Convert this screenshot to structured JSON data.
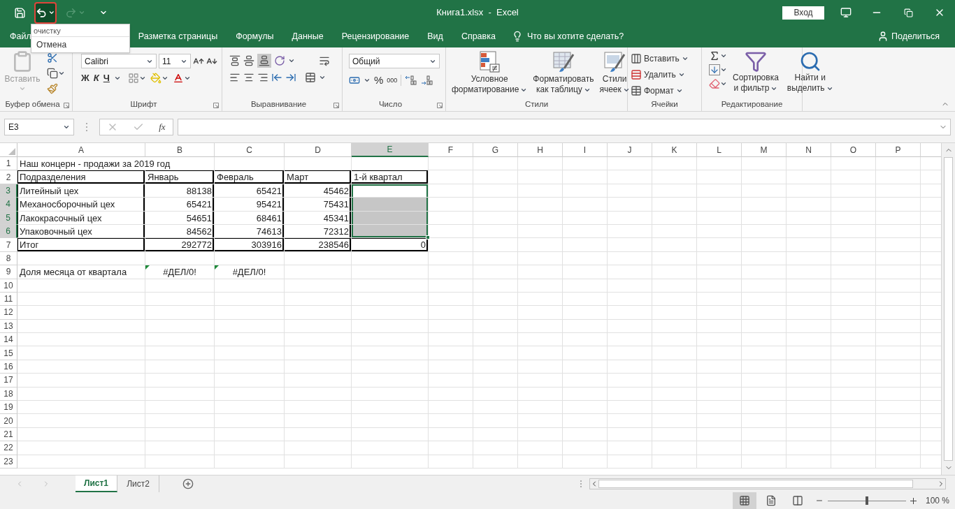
{
  "window": {
    "title": "Книга1.xlsx  -  Excel",
    "sign_in": "Вход"
  },
  "undo_menu": {
    "header": "очистку",
    "items": [
      {
        "label": "Отмена"
      }
    ]
  },
  "tabs": [
    {
      "label": "Файл"
    },
    {
      "label": "Разметка страницы"
    },
    {
      "label": "Формулы"
    },
    {
      "label": "Данные"
    },
    {
      "label": "Рецензирование"
    },
    {
      "label": "Вид"
    },
    {
      "label": "Справка"
    }
  ],
  "tell_me": "Что вы хотите сделать?",
  "share": "Поделиться",
  "ribbon": {
    "clipboard": {
      "paste": "Вставить",
      "label": "Буфер обмена"
    },
    "font": {
      "name": "Calibri",
      "size": "11",
      "bold": "Ж",
      "italic": "К",
      "underline": "Ч",
      "label": "Шрифт"
    },
    "alignment": {
      "label": "Выравнивание"
    },
    "number": {
      "format": "Общий",
      "percent": "%",
      "thousands": "000",
      "label": "Число"
    },
    "styles": {
      "label": "Стили",
      "buttons": [
        {
          "kind": "conditional",
          "lines": [
            "Условное",
            "форматирование"
          ]
        },
        {
          "kind": "table",
          "lines": [
            "Форматировать",
            "как таблицу"
          ]
        },
        {
          "kind": "cell_styles",
          "lines": [
            "Стили",
            "ячеек"
          ]
        }
      ]
    },
    "cells": {
      "label": "Ячейки",
      "buttons": [
        {
          "kind": "insert",
          "label": "Вставить"
        },
        {
          "kind": "delete",
          "label": "Удалить"
        },
        {
          "kind": "format",
          "label": "Формат"
        }
      ]
    },
    "editing": {
      "label": "Редактирование",
      "buttons": [
        {
          "kind": "sort",
          "lines": [
            "Сортировка",
            "и фильтр"
          ]
        },
        {
          "kind": "find",
          "lines": [
            "Найти и",
            "выделить"
          ]
        }
      ]
    }
  },
  "formula_bar": {
    "name_box": "E3",
    "function_label": "fx"
  },
  "sheet": {
    "columns": [
      {
        "label": "A",
        "selected": false
      },
      {
        "label": "B",
        "selected": false
      },
      {
        "label": "C",
        "selected": false
      },
      {
        "label": "D",
        "selected": false
      },
      {
        "label": "E",
        "selected": true
      },
      {
        "label": "F",
        "selected": false
      },
      {
        "label": "G",
        "selected": false
      },
      {
        "label": "H",
        "selected": false
      },
      {
        "label": "I",
        "selected": false
      },
      {
        "label": "J",
        "selected": false
      },
      {
        "label": "K",
        "selected": false
      },
      {
        "label": "L",
        "selected": false
      },
      {
        "label": "M",
        "selected": false
      },
      {
        "label": "N",
        "selected": false
      },
      {
        "label": "O",
        "selected": false
      },
      {
        "label": "P",
        "selected": false
      }
    ],
    "rows": [
      {
        "number": "1",
        "kind": "plain",
        "selected": false,
        "cells": [
          {
            "kind": "spill",
            "text": "Наш концерн - продажи за 2019 год",
            "selected": false
          }
        ]
      },
      {
        "number": "2",
        "kind": "header",
        "selected": false,
        "cells": [
          {
            "kind": "text",
            "text": "Подразделения",
            "selected": false
          },
          {
            "kind": "text",
            "text": "Январь",
            "selected": false
          },
          {
            "kind": "text",
            "text": "Февраль",
            "selected": false
          },
          {
            "kind": "text",
            "text": "Март",
            "selected": false
          },
          {
            "kind": "text",
            "text": "1-й квартал",
            "selected": false
          }
        ]
      },
      {
        "number": "3",
        "kind": "body",
        "selected": true,
        "cells": [
          {
            "kind": "text",
            "text": "Литейный цех",
            "selected": false
          },
          {
            "kind": "number",
            "text": "88138",
            "selected": false
          },
          {
            "kind": "number",
            "text": "65421",
            "selected": false
          },
          {
            "kind": "number",
            "text": "45462",
            "selected": false
          },
          {
            "kind": "empty",
            "selected": true,
            "active": true
          }
        ]
      },
      {
        "number": "4",
        "kind": "body",
        "selected": true,
        "cells": [
          {
            "kind": "text",
            "text": "Механосборочный цех",
            "selected": false
          },
          {
            "kind": "number",
            "text": "65421",
            "selected": false
          },
          {
            "kind": "number",
            "text": "95421",
            "selected": false
          },
          {
            "kind": "number",
            "text": "75431",
            "selected": false
          },
          {
            "kind": "empty",
            "selected": true,
            "active": false
          }
        ]
      },
      {
        "number": "5",
        "kind": "body",
        "selected": true,
        "cells": [
          {
            "kind": "text",
            "text": "Лакокрасочный цех",
            "selected": false
          },
          {
            "kind": "number",
            "text": "54651",
            "selected": false
          },
          {
            "kind": "number",
            "text": "68461",
            "selected": false
          },
          {
            "kind": "number",
            "text": "45341",
            "selected": false
          },
          {
            "kind": "empty",
            "selected": true,
            "active": false
          }
        ]
      },
      {
        "number": "6",
        "kind": "body",
        "selected": true,
        "cells": [
          {
            "kind": "text",
            "text": "Упаковочный цех",
            "selected": false
          },
          {
            "kind": "number",
            "text": "84562",
            "selected": false
          },
          {
            "kind": "number",
            "text": "74613",
            "selected": false
          },
          {
            "kind": "number",
            "text": "72312",
            "selected": false
          },
          {
            "kind": "empty",
            "selected": true,
            "active": false
          }
        ]
      },
      {
        "number": "7",
        "kind": "total",
        "selected": false,
        "cells": [
          {
            "kind": "text",
            "text": "Итог",
            "selected": false
          },
          {
            "kind": "number",
            "text": "292772",
            "selected": false
          },
          {
            "kind": "number",
            "text": "303916",
            "selected": false
          },
          {
            "kind": "number",
            "text": "238546",
            "selected": false
          },
          {
            "kind": "number",
            "text": "0",
            "selected": false
          }
        ]
      },
      {
        "number": "8",
        "kind": "plain",
        "selected": false
      },
      {
        "number": "9",
        "kind": "plain",
        "selected": false,
        "cells": [
          {
            "kind": "text",
            "text": "Доля месяца от квартала",
            "selected": false
          },
          {
            "kind": "error",
            "text": "#ДЕЛ/0!",
            "selected": false
          },
          {
            "kind": "error",
            "text": "#ДЕЛ/0!",
            "selected": false
          }
        ]
      },
      {
        "number": "10",
        "kind": "plain",
        "selected": false
      },
      {
        "number": "11",
        "kind": "plain",
        "selected": false
      },
      {
        "number": "12",
        "kind": "plain",
        "selected": false
      },
      {
        "number": "13",
        "kind": "plain",
        "selected": false
      },
      {
        "number": "14",
        "kind": "plain",
        "selected": false
      },
      {
        "number": "15",
        "kind": "plain",
        "selected": false
      },
      {
        "number": "16",
        "kind": "plain",
        "selected": false
      },
      {
        "number": "17",
        "kind": "plain",
        "selected": false
      },
      {
        "number": "18",
        "kind": "plain",
        "selected": false
      },
      {
        "number": "19",
        "kind": "plain",
        "selected": false
      },
      {
        "number": "20",
        "kind": "plain",
        "selected": false
      },
      {
        "number": "21",
        "kind": "plain",
        "selected": false
      },
      {
        "number": "22",
        "kind": "plain",
        "selected": false
      },
      {
        "number": "23",
        "kind": "plain",
        "selected": false
      }
    ]
  },
  "sheet_tabs": [
    {
      "label": "Лист1",
      "selected": true
    },
    {
      "label": "Лист2",
      "selected": false
    }
  ],
  "views": [
    {
      "kind": "normal",
      "selected": true
    },
    {
      "kind": "page_layout",
      "selected": false
    },
    {
      "kind": "page_break",
      "selected": false
    }
  ],
  "zoom": {
    "level": 0.5,
    "reading": "100 %"
  }
}
